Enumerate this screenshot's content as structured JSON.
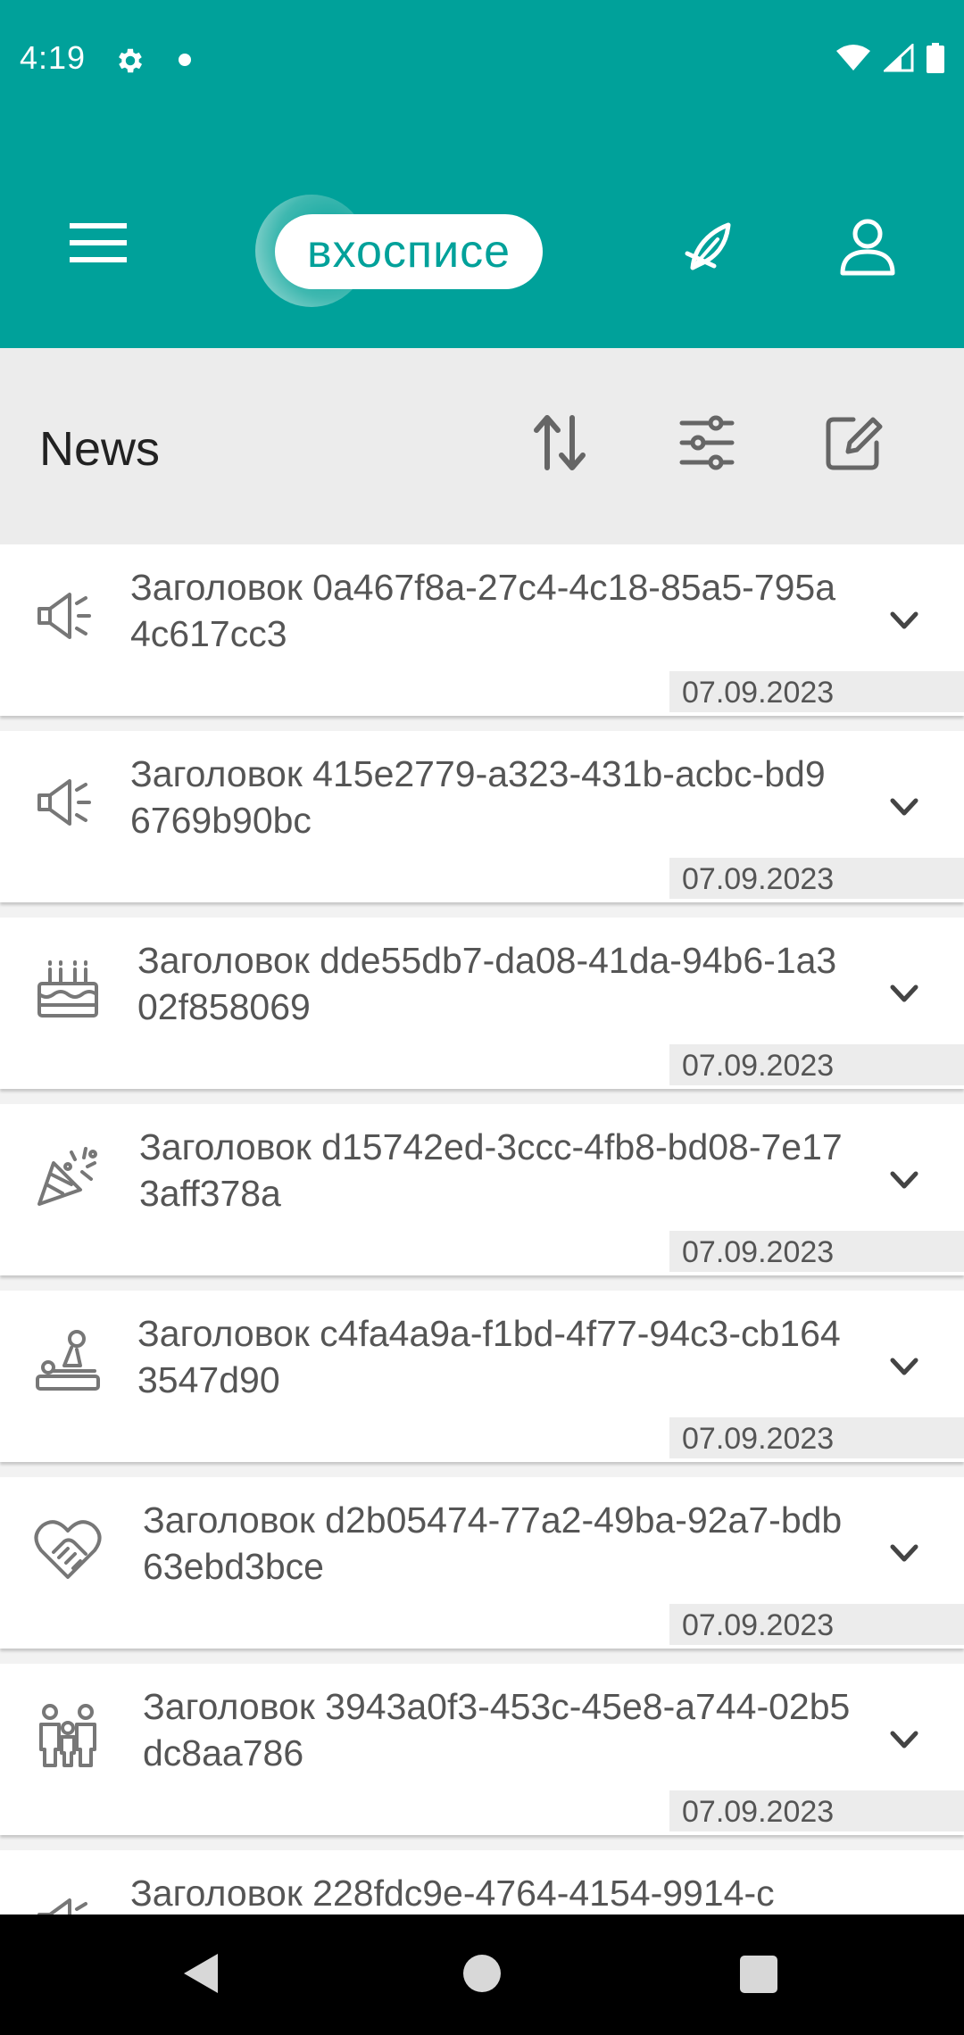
{
  "status_bar": {
    "time": "4:19"
  },
  "app_bar": {
    "logo_text": "вхосписе"
  },
  "toolbar": {
    "title": "News"
  },
  "news": [
    {
      "title": "Заголовок 0a467f8a-27c4-4c18-85a5-795a4c617cc3",
      "date": "07.09.2023",
      "icon": "megaphone-icon"
    },
    {
      "title": "Заголовок 415e2779-a323-431b-acbc-bd96769b90bc",
      "date": "07.09.2023",
      "icon": "megaphone-icon"
    },
    {
      "title": "Заголовок dde55db7-da08-41da-94b6-1a302f858069",
      "date": "07.09.2023",
      "icon": "birthday-cake-icon"
    },
    {
      "title": "Заголовок d15742ed-3ccc-4fb8-bd08-7e173aff378a",
      "date": "07.09.2023",
      "icon": "party-popper-icon"
    },
    {
      "title": "Заголовок c4fa4a9a-f1bd-4f77-94c3-cb1643547d90",
      "date": "07.09.2023",
      "icon": "massage-icon"
    },
    {
      "title": "Заголовок d2b05474-77a2-49ba-92a7-bdb63ebd3bce",
      "date": "07.09.2023",
      "icon": "heart-handshake-icon"
    },
    {
      "title": "Заголовок 3943a0f3-453c-45e8-a744-02b5dc8aa786",
      "date": "07.09.2023",
      "icon": "family-icon"
    },
    {
      "title": "Заголовок 228fdc9e-4764-4154-9914-c",
      "date": "",
      "icon": "megaphone-icon"
    }
  ],
  "colors": {
    "brand": "#00a19a",
    "toolbar_bg": "#ececec",
    "text": "#555555"
  }
}
